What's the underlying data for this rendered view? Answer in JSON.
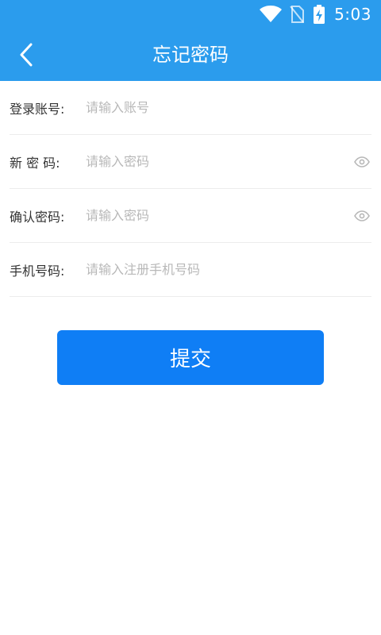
{
  "status_bar": {
    "time": "5:03",
    "icons": [
      "wifi-icon",
      "no-sim-icon",
      "battery-charging-icon"
    ]
  },
  "toolbar": {
    "title": "忘记密码",
    "back_icon": "chevron-left-icon"
  },
  "form": {
    "fields": [
      {
        "label": "登录账号:",
        "placeholder": "请输入账号",
        "value": ""
      },
      {
        "label": "新 密 码:",
        "placeholder": "请输入密码",
        "value": "",
        "toggle_icon": "eye-icon"
      },
      {
        "label": "确认密码:",
        "placeholder": "请输入密码",
        "value": "",
        "toggle_icon": "eye-icon"
      },
      {
        "label": "手机号码:",
        "placeholder": "请输入注册手机号码",
        "value": ""
      }
    ]
  },
  "submit": {
    "label": "提交"
  },
  "colors": {
    "header_bg": "#2b9ced",
    "button_bg": "#0f7ef5",
    "placeholder": "#b8b8b8",
    "label": "#333333",
    "divider": "#ececec"
  }
}
